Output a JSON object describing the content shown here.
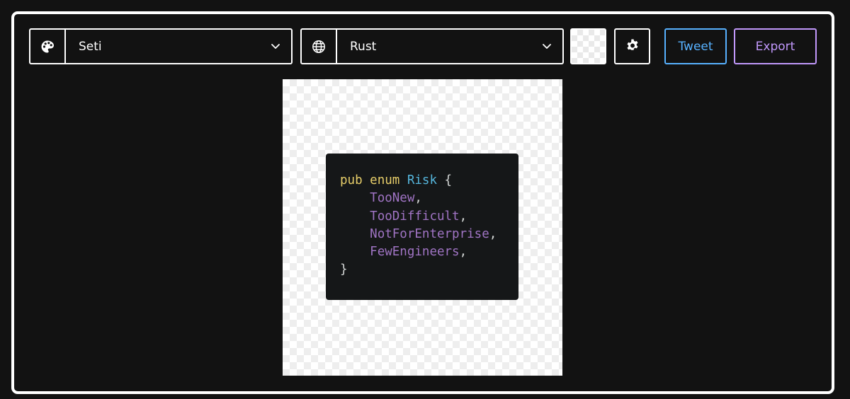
{
  "toolbar": {
    "theme": {
      "icon": "palette-icon",
      "value": "Seti"
    },
    "language": {
      "icon": "globe-icon",
      "value": "Rust"
    },
    "background_swatch": {
      "pattern": "transparent-checker"
    },
    "settings": {
      "icon": "gear-icon"
    },
    "tweet_label": "Tweet",
    "export_label": "Export"
  },
  "code": {
    "lines": [
      [
        {
          "t": "pub",
          "k": "kw"
        },
        {
          "t": " ",
          "k": "punct"
        },
        {
          "t": "enum",
          "k": "kw"
        },
        {
          "t": " ",
          "k": "punct"
        },
        {
          "t": "Risk",
          "k": "type"
        },
        {
          "t": " {",
          "k": "punct"
        }
      ],
      [
        {
          "t": "    ",
          "k": "punct"
        },
        {
          "t": "TooNew",
          "k": "variant"
        },
        {
          "t": ",",
          "k": "punct"
        }
      ],
      [
        {
          "t": "    ",
          "k": "punct"
        },
        {
          "t": "TooDifficult",
          "k": "variant"
        },
        {
          "t": ",",
          "k": "punct"
        }
      ],
      [
        {
          "t": "    ",
          "k": "punct"
        },
        {
          "t": "NotForEnterprise",
          "k": "variant"
        },
        {
          "t": ",",
          "k": "punct"
        }
      ],
      [
        {
          "t": "    ",
          "k": "punct"
        },
        {
          "t": "FewEngineers",
          "k": "variant"
        },
        {
          "t": ",",
          "k": "punct"
        }
      ],
      [
        {
          "t": "}",
          "k": "punct"
        }
      ]
    ]
  },
  "colors": {
    "page_bg": "#121212",
    "frame_border": "#ffffff",
    "tweet_accent": "#57b1ff",
    "export_accent": "#c198fb",
    "code_bg": "#151718",
    "keyword": "#e6cd69",
    "type": "#55b5db",
    "variant": "#a074c4",
    "text": "#d4d7d6"
  }
}
